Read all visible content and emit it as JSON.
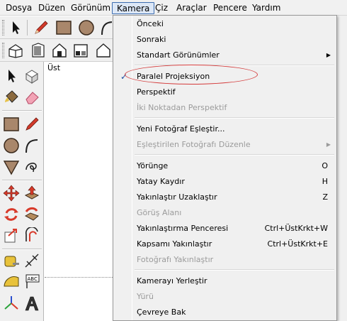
{
  "menubar": {
    "items": [
      "Dosya",
      "Düzen",
      "Görünüm",
      "Kamera",
      "Çiz",
      "Araçlar",
      "Pencere",
      "Yardım"
    ],
    "active_index": 3
  },
  "canvas": {
    "view_label": "Üst"
  },
  "camera_menu": {
    "items": [
      {
        "label": "Önceki",
        "shortcut": "",
        "enabled": true,
        "submenu": false,
        "checked": false
      },
      {
        "label": "Sonraki",
        "shortcut": "",
        "enabled": true,
        "submenu": false,
        "checked": false
      },
      {
        "label": "Standart Görünümler",
        "shortcut": "",
        "enabled": true,
        "submenu": true,
        "checked": false
      },
      {
        "label": "Paralel Projeksiyon",
        "shortcut": "",
        "enabled": true,
        "submenu": false,
        "checked": true
      },
      {
        "label": "Perspektif",
        "shortcut": "",
        "enabled": true,
        "submenu": false,
        "checked": false
      },
      {
        "label": "İki Noktadan Perspektif",
        "shortcut": "",
        "enabled": false,
        "submenu": false,
        "checked": false
      },
      {
        "label": "Yeni Fotoğraf Eşleştir...",
        "shortcut": "",
        "enabled": true,
        "submenu": false,
        "checked": false
      },
      {
        "label": "Eşleştirilen Fotoğrafı Düzenle",
        "shortcut": "",
        "enabled": false,
        "submenu": true,
        "checked": false
      },
      {
        "label": "Yörünge",
        "shortcut": "O",
        "enabled": true,
        "submenu": false,
        "checked": false
      },
      {
        "label": "Yatay Kaydır",
        "shortcut": "H",
        "enabled": true,
        "submenu": false,
        "checked": false
      },
      {
        "label": "Yakınlaştır Uzaklaştır",
        "shortcut": "Z",
        "enabled": true,
        "submenu": false,
        "checked": false
      },
      {
        "label": "Görüş Alanı",
        "shortcut": "",
        "enabled": false,
        "submenu": false,
        "checked": false
      },
      {
        "label": "Yakınlaştırma Penceresi",
        "shortcut": "Ctrl+ÜstKrkt+W",
        "enabled": true,
        "submenu": false,
        "checked": false
      },
      {
        "label": "Kapsamı Yakınlaştır",
        "shortcut": "Ctrl+ÜstKrkt+E",
        "enabled": true,
        "submenu": false,
        "checked": false
      },
      {
        "label": "Fotoğrafı Yakınlaştır",
        "shortcut": "",
        "enabled": false,
        "submenu": false,
        "checked": false
      },
      {
        "label": "Kamerayı Yerleştir",
        "shortcut": "",
        "enabled": true,
        "submenu": false,
        "checked": false
      },
      {
        "label": "Yürü",
        "shortcut": "",
        "enabled": false,
        "submenu": false,
        "checked": false
      },
      {
        "label": "Çevreye Bak",
        "shortcut": "",
        "enabled": true,
        "submenu": false,
        "checked": false
      }
    ],
    "check_glyph": "✓",
    "submenu_glyph": "▶"
  },
  "colors": {
    "highlight_ellipse": "#d43a3a",
    "active_menu_border": "#3c6db0",
    "check": "#1b4ea3"
  },
  "toolbar_top_icons": [
    "select-arrow-icon",
    "pencil-icon",
    "rectangle-icon",
    "circle-icon",
    "arc-icon"
  ],
  "toolbar_views_icons": [
    "iso-view-icon",
    "top-view-icon",
    "front-view-icon",
    "right-view-icon",
    "back-view-icon",
    "left-view-icon"
  ],
  "palette_icons": [
    "select-icon",
    "component-icon",
    "paint-bucket-icon",
    "eraser-icon",
    "rectangle-icon",
    "line-icon",
    "circle-icon",
    "arc-icon",
    "polygon-icon",
    "freehand-icon",
    "move-icon",
    "push-pull-icon",
    "rotate-icon",
    "follow-me-icon",
    "scale-icon",
    "offset-icon",
    "tape-measure-icon",
    "dimension-icon",
    "protractor-icon",
    "text-icon",
    "axes-icon",
    "3d-text-icon"
  ]
}
